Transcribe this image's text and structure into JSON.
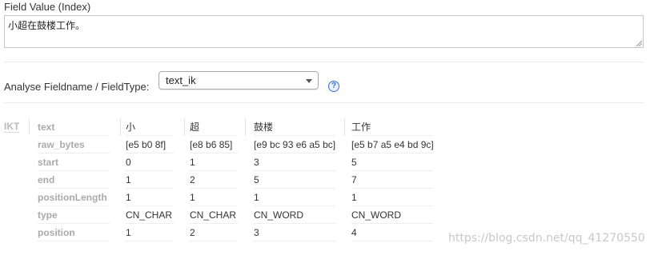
{
  "field_value": {
    "label": "Field Value (Index)",
    "text": "小超在鼓楼工作。"
  },
  "analyse": {
    "label": "Analyse Fieldname / FieldType:",
    "selected": "text_ik",
    "help": "?"
  },
  "analysis": {
    "stage": "IKT",
    "row_labels": [
      "text",
      "raw_bytes",
      "start",
      "end",
      "positionLength",
      "type",
      "position"
    ],
    "tokens": [
      {
        "text": "小",
        "raw_bytes": "[e5 b0 8f]",
        "start": "0",
        "end": "1",
        "positionLength": "1",
        "type": "CN_CHAR",
        "position": "1"
      },
      {
        "text": "超",
        "raw_bytes": "[e8 b6 85]",
        "start": "1",
        "end": "2",
        "positionLength": "1",
        "type": "CN_CHAR",
        "position": "2"
      },
      {
        "text": "鼓楼",
        "raw_bytes": "[e9 bc 93 e6 a5 bc]",
        "start": "3",
        "end": "5",
        "positionLength": "1",
        "type": "CN_WORD",
        "position": "3"
      },
      {
        "text": "工作",
        "raw_bytes": "[e5 b7 a5 e4 bd 9c]",
        "start": "5",
        "end": "7",
        "positionLength": "1",
        "type": "CN_WORD",
        "position": "4"
      }
    ]
  },
  "watermark": "https://blog.csdn.net/qq_41270550"
}
